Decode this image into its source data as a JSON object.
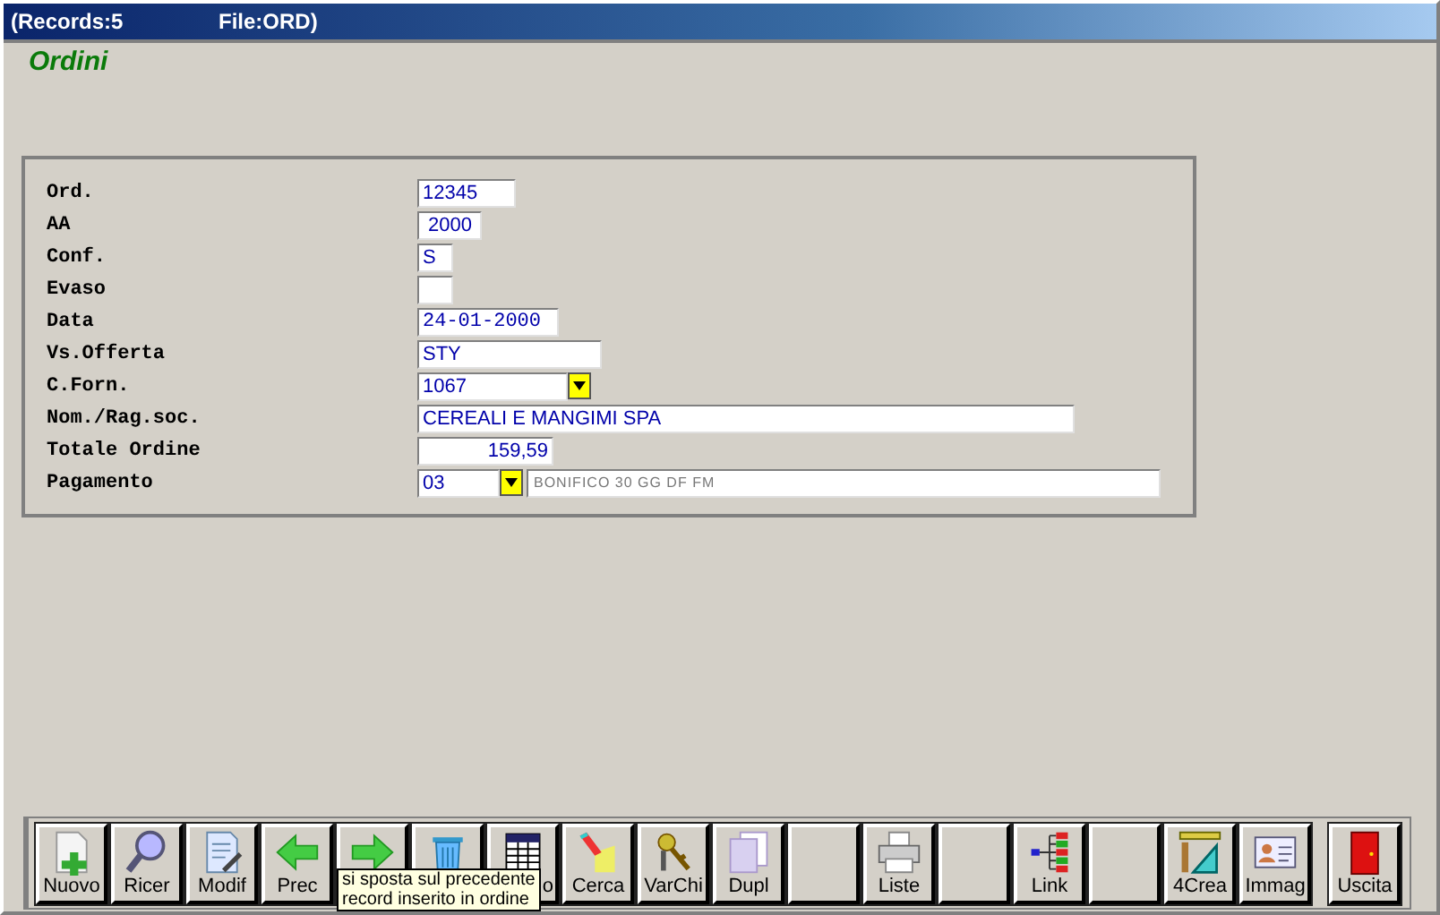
{
  "window": {
    "title_records": "(Records:5",
    "title_file": "File:ORD)"
  },
  "form_title": "Ordini",
  "fields": [
    {
      "label": "Ord.",
      "kind": "text",
      "value": "12345"
    },
    {
      "label": "AA",
      "kind": "text",
      "value": " 2000"
    },
    {
      "label": "Conf.",
      "kind": "text",
      "value": "S"
    },
    {
      "label": "Evaso",
      "kind": "text"
    },
    {
      "label": "Data",
      "kind": "text",
      "value": "24-01-2000"
    },
    {
      "label": "Vs.Offerta",
      "kind": "text",
      "value": "STY"
    },
    {
      "label": "C.Forn.",
      "kind": "combo",
      "value": "1067"
    },
    {
      "label": "Nom./Rag.soc.",
      "kind": "text",
      "value": "CEREALI E MANGIMI SPA"
    },
    {
      "label": "Totale Ordine",
      "kind": "number",
      "value": "159,59"
    },
    {
      "label": "Pagamento",
      "kind": "combo",
      "value": "03",
      "description": "BONIFICO 30 GG DF FM"
    }
  ],
  "toolbar": [
    {
      "kind": "icon",
      "label": "Nuovo"
    },
    {
      "kind": "icon",
      "label": "Ricer"
    },
    {
      "kind": "icon",
      "label": "Modif"
    },
    {
      "kind": "icon",
      "label": "Prec"
    },
    {
      "kind": "icon"
    },
    {
      "kind": "icon"
    },
    {
      "kind": "icon",
      "label": "o"
    },
    {
      "kind": "icon",
      "label": "Cerca"
    },
    {
      "kind": "icon",
      "label": "VarChi"
    },
    {
      "kind": "icon",
      "label": "Dupl"
    },
    {
      "kind": "blank"
    },
    {
      "kind": "icon",
      "label": "Liste"
    },
    {
      "kind": "blank"
    },
    {
      "kind": "icon",
      "label": "Link"
    },
    {
      "kind": "blank"
    },
    {
      "kind": "icon",
      "label": "4Crea"
    },
    {
      "kind": "icon",
      "label": "Immag"
    },
    {
      "kind": "icon",
      "label": "Uscita"
    }
  ],
  "tooltip": [
    "si sposta sul precedente",
    "record inserito in ordine"
  ]
}
